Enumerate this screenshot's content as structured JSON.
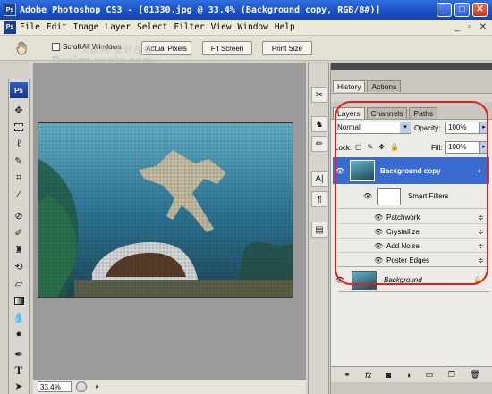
{
  "window": {
    "app_icon": "Ps",
    "title": "Adobe Photoshop CS3 - [01330.jpg @ 33.4% (Background copy, RGB/8#)]",
    "minimize": "_",
    "maximize": "□",
    "close": "✕"
  },
  "menu": {
    "items": [
      "File",
      "Edit",
      "Image",
      "Layer",
      "Select",
      "Filter",
      "View",
      "Window",
      "Help"
    ],
    "mdi": [
      "_",
      "▫",
      "✕"
    ]
  },
  "options": {
    "scroll_all_windows": "Scroll All Windows",
    "actual_pixels": "Actual Pixels",
    "fit_screen": "Fit Screen",
    "print_size": "Print Size"
  },
  "watermark": {
    "line1": "天极网·设计在线",
    "line2": "Design.yesky.com"
  },
  "toolbox": {
    "logo": "Ps",
    "tools": [
      "move-tool",
      "marquee-tool",
      "lasso-tool",
      "quick-select-tool",
      "crop-tool",
      "eyedropper-tool",
      "healing-brush-tool",
      "brush-tool",
      "clone-stamp-tool",
      "history-brush-tool",
      "eraser-tool",
      "gradient-tool",
      "blur-tool",
      "dodge-tool",
      "pen-tool",
      "type-tool",
      "path-select-tool"
    ]
  },
  "status": {
    "zoom": "33.4%"
  },
  "panels": {
    "top_tabs": [
      "History",
      "Actions"
    ],
    "layer_tabs": [
      "Layers",
      "Channels",
      "Paths"
    ],
    "blend_mode": "Normal",
    "opacity_label": "Opacity:",
    "opacity_value": "100%",
    "lock_label": "Lock:",
    "fill_label": "Fill:",
    "fill_value": "100%",
    "layers": [
      {
        "name": "Background copy",
        "selected": true
      },
      {
        "name": "Smart Filters"
      },
      {
        "name": "Patchwork"
      },
      {
        "name": "Crystallize"
      },
      {
        "name": "Add Noise"
      },
      {
        "name": "Poster Edges"
      },
      {
        "name": "Background"
      }
    ],
    "bottom_icons": [
      "link-icon",
      "fx-icon",
      "mask-icon",
      "adjustment-icon",
      "folder-icon",
      "new-layer-icon",
      "trash-icon"
    ]
  },
  "colors": {
    "titlebar": "#1b4fc4",
    "selected_layer": "#3a6bd0",
    "annotation_red": "#e51c1c"
  }
}
